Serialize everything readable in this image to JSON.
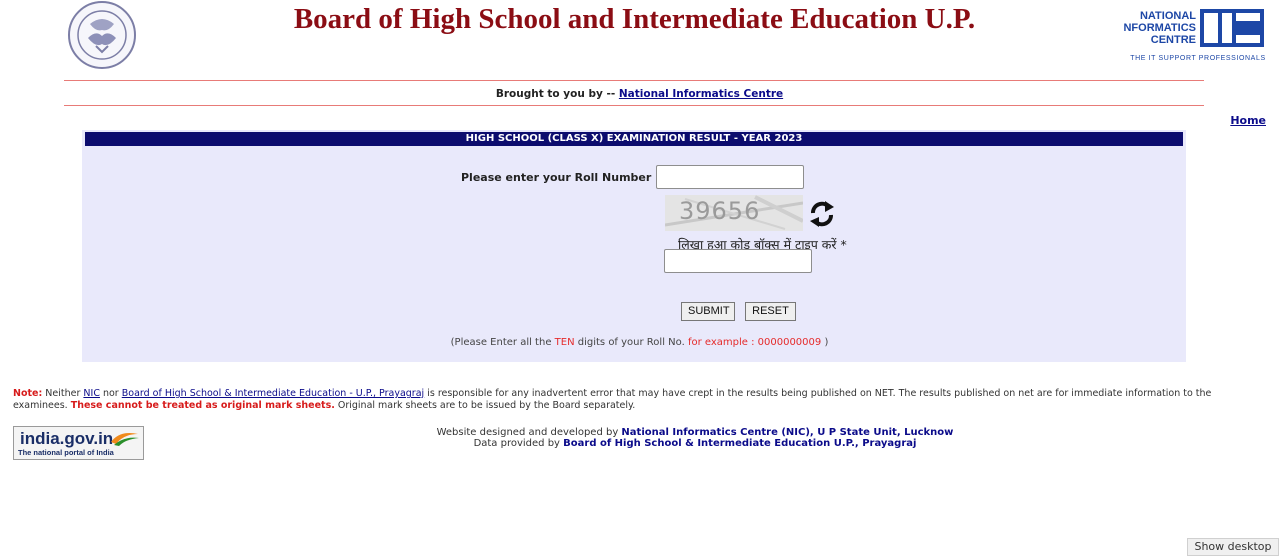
{
  "header": {
    "title": "Board of High School and Intermediate Education U.P.",
    "nic_logo_lines": [
      "NATIONAL",
      "INFORMATICS",
      "CENTRE"
    ],
    "nic_tagline": "THE IT SUPPORT PROFESSIONALS"
  },
  "brought_by": {
    "prefix": "Brought to you by -- ",
    "link": "National Informatics Centre"
  },
  "nav": {
    "home": "Home"
  },
  "form": {
    "heading": "HIGH SCHOOL (CLASS X)  EXAMINATION RESULT - YEAR 2023",
    "roll_label": "Please enter your Roll Number",
    "roll_value": "",
    "captcha_code": "39656",
    "captcha_instruction": "लिखा हुआ कोड बॉक्स में टाइप करें *",
    "captcha_value": "",
    "submit_label": "SUBMIT",
    "reset_label": "RESET",
    "hint_pre": "(Please Enter all the ",
    "hint_ten": "TEN",
    "hint_mid": " digits of your Roll No. ",
    "hint_example": "for example : 0000000009",
    "hint_post": " )"
  },
  "note": {
    "label": "Note:",
    "t1": " Neither ",
    "nic_link": "NIC",
    "t2": " nor ",
    "board_link": "Board of High School & Intermediate Education - U.P., Prayagraj",
    "t3": " is responsible for any inadvertent error that may have crept in the results being published on NET. The results published on net are for immediate information to the examinees. ",
    "warning": "These cannot be treated as original mark sheets.",
    "t4": " Original mark sheets are to be issued by the Board separately."
  },
  "footer": {
    "india_gov_title": "india.gov.in",
    "india_gov_sub": "The national portal of India",
    "designed_pre": "Website designed and developed by ",
    "designed_by": "National Informatics Centre (NIC), U P State Unit, Lucknow",
    "data_pre": "Data provided by ",
    "data_by": "Board of High School & Intermediate Education U.P., Prayagraj"
  },
  "taskbar": {
    "show_desktop": "Show desktop"
  },
  "colors": {
    "title": "#8b0d14",
    "header_bar": "#0c0c6e",
    "panel_bg": "#e9e9fb",
    "link": "#0b0b8a",
    "warning": "#d71b1b"
  }
}
